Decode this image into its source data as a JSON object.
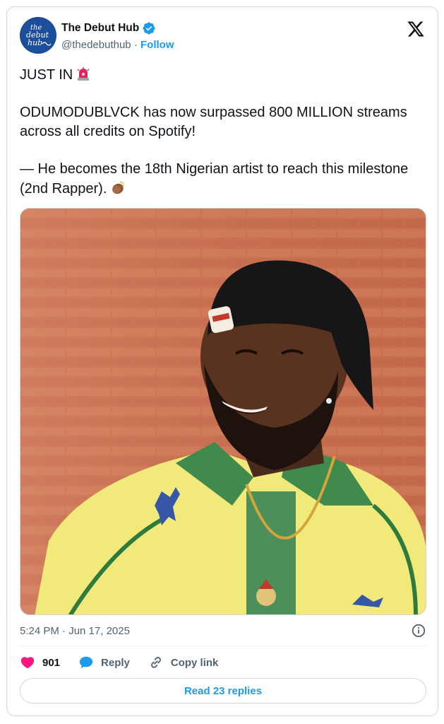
{
  "author": {
    "display_name": "The Debut Hub",
    "handle": "@thedebuthub",
    "separator": " · ",
    "follow_label": "Follow",
    "avatar_text": [
      "the",
      "debut",
      "hub"
    ]
  },
  "tweet": {
    "lines": [
      "JUST IN",
      "ODUMODUBLVCK has now surpassed 800 MILLION streams across all credits on Spotify!",
      "— He becomes the 18th Nigerian artist to reach this milestone (2nd Rapper)."
    ],
    "timestamp": "5:24 PM · Jun 17, 2025"
  },
  "actions": {
    "likes": "901",
    "reply_label": "Reply",
    "copy_label": "Copy link"
  },
  "read_replies_label": "Read 23 replies",
  "icons": {
    "verified": "verified-badge-icon",
    "x_logo": "x-logo-icon",
    "siren_emoji": "siren-emoji",
    "clap_emoji": "clapping-hands-emoji",
    "info": "info-icon",
    "heart": "heart-icon",
    "reply": "speech-bubble-icon",
    "copy_link": "link-icon"
  },
  "colors": {
    "accent": "#1d9bf0",
    "heart": "#f91880",
    "avatar_bg": "#1d4e9c"
  }
}
